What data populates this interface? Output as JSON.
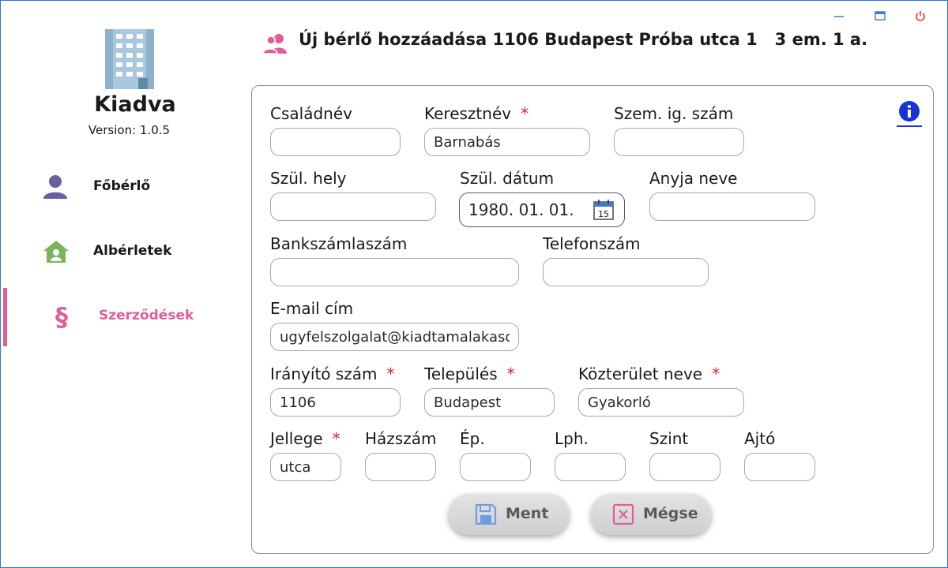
{
  "app": {
    "name": "Kiadva",
    "version": "Version: 1.0.5"
  },
  "sidebar": {
    "items": [
      {
        "label": "Főbérlő",
        "icon": "person-icon",
        "active": false
      },
      {
        "label": "Albérletek",
        "icon": "house-person-icon",
        "active": false
      },
      {
        "label": "Szerződések",
        "icon": "paragraph-icon",
        "active": true
      }
    ]
  },
  "header": {
    "title": "Új bérlő hozzáadása 1106 Budapest Próba utca 1   3 em. 1 a."
  },
  "form": {
    "fields": {
      "csaladnev": {
        "label": "Családnév",
        "value": ""
      },
      "keresztnev": {
        "label": "Keresztnév",
        "value": "Barnabás",
        "required": "*"
      },
      "szemig": {
        "label": "Szem. ig. szám",
        "value": ""
      },
      "szulhely": {
        "label": "Szül. hely",
        "value": ""
      },
      "szuldatum": {
        "label": "Szül. dátum",
        "value": "1980. 01. 01."
      },
      "anyjaneve": {
        "label": "Anyja neve",
        "value": ""
      },
      "bankszamla": {
        "label": "Bankszámlaszám",
        "value": ""
      },
      "telefon": {
        "label": "Telefonszám",
        "value": ""
      },
      "email": {
        "label": "E-mail cím",
        "value": "ugyfelszolgalat@kiadtamalakasomat.hu"
      },
      "iranyito": {
        "label": "Irányító szám",
        "value": "1106",
        "required": "*"
      },
      "telepules": {
        "label": "Település",
        "value": "Budapest",
        "required": "*"
      },
      "kozterulet": {
        "label": "Közterület neve",
        "value": "Gyakorló",
        "required": "*"
      },
      "jellege": {
        "label": "Jellege",
        "value": "utca",
        "required": "*"
      },
      "hazszam": {
        "label": "Házszám",
        "value": ""
      },
      "ep": {
        "label": "Ép.",
        "value": ""
      },
      "lph": {
        "label": "Lph.",
        "value": ""
      },
      "szint": {
        "label": "Szint",
        "value": ""
      },
      "ajto": {
        "label": "Ajtó",
        "value": ""
      }
    },
    "buttons": {
      "save": "Ment",
      "cancel": "Mégse"
    }
  },
  "colors": {
    "accent": "#e35c95",
    "required": "#d9252b",
    "info": "#1733d8",
    "window_border": "#2b78d4"
  }
}
